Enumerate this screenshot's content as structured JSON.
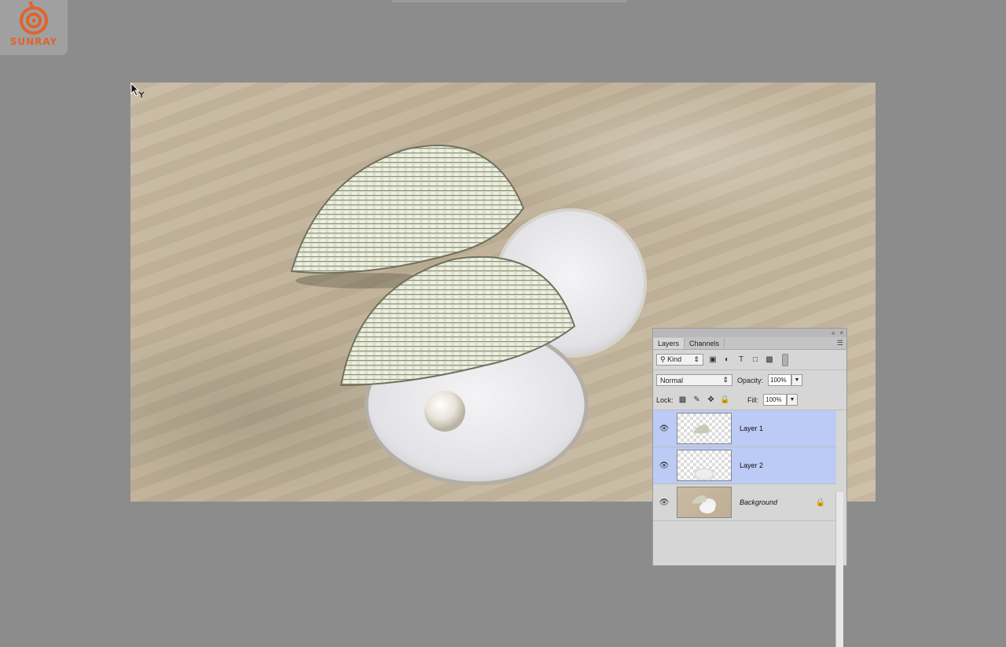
{
  "logo": {
    "text": "SUNRAY",
    "icon": "spiral-logo-icon",
    "color": "#e0632e"
  },
  "canvas": {
    "cursor": "move-tool-cursor-icon"
  },
  "layers_panel": {
    "tabs": [
      {
        "label": "Layers",
        "active": true
      },
      {
        "label": "Channels",
        "active": false
      }
    ],
    "filter": {
      "kind": "Kind",
      "icons": [
        "pixel-filter-icon",
        "adjustment-filter-icon",
        "type-filter-icon",
        "shape-filter-icon",
        "smart-object-filter-icon"
      ]
    },
    "blend_mode": "Normal",
    "opacity_label": "Opacity:",
    "opacity_value": "100%",
    "lock_label": "Lock:",
    "fill_label": "Fill:",
    "fill_value": "100%",
    "layers": [
      {
        "name": "Layer 1",
        "selected": true,
        "visible": true
      },
      {
        "name": "Layer 2",
        "selected": true,
        "visible": true
      },
      {
        "name": "Background",
        "selected": false,
        "visible": true,
        "locked": true
      }
    ],
    "selected_color": "#bccbf5"
  }
}
